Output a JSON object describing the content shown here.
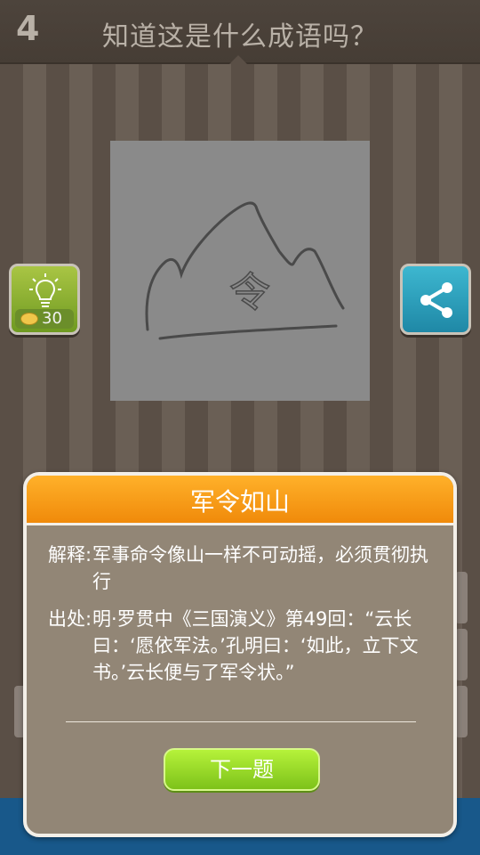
{
  "header": {
    "level": "4",
    "question": "知道这是什么成语吗？"
  },
  "hint_button": {
    "icon": "lightbulb-icon",
    "cost": "30",
    "coin_icon": "coin-icon"
  },
  "share_button": {
    "icon": "share-icon"
  },
  "dialog": {
    "title": "军令如山",
    "explanation_label": "解释:",
    "explanation": "军事命令像山一样不可动摇，必须贯彻执行",
    "source_label": "出处:",
    "source": "明·罗贯中《三国演义》第49回：“云长曰：‘愿依军法。’孔明曰：‘如此，立下文书。’云长便与了军令状。”",
    "next_label": "下一题"
  },
  "picture": {
    "char": "令"
  },
  "colors": {
    "title_bar": "#f5950f",
    "next_button": "#9ad82a",
    "dialog_bg": "#928676",
    "hint_bg": "#8db532",
    "share_bg": "#2aa1bf"
  }
}
